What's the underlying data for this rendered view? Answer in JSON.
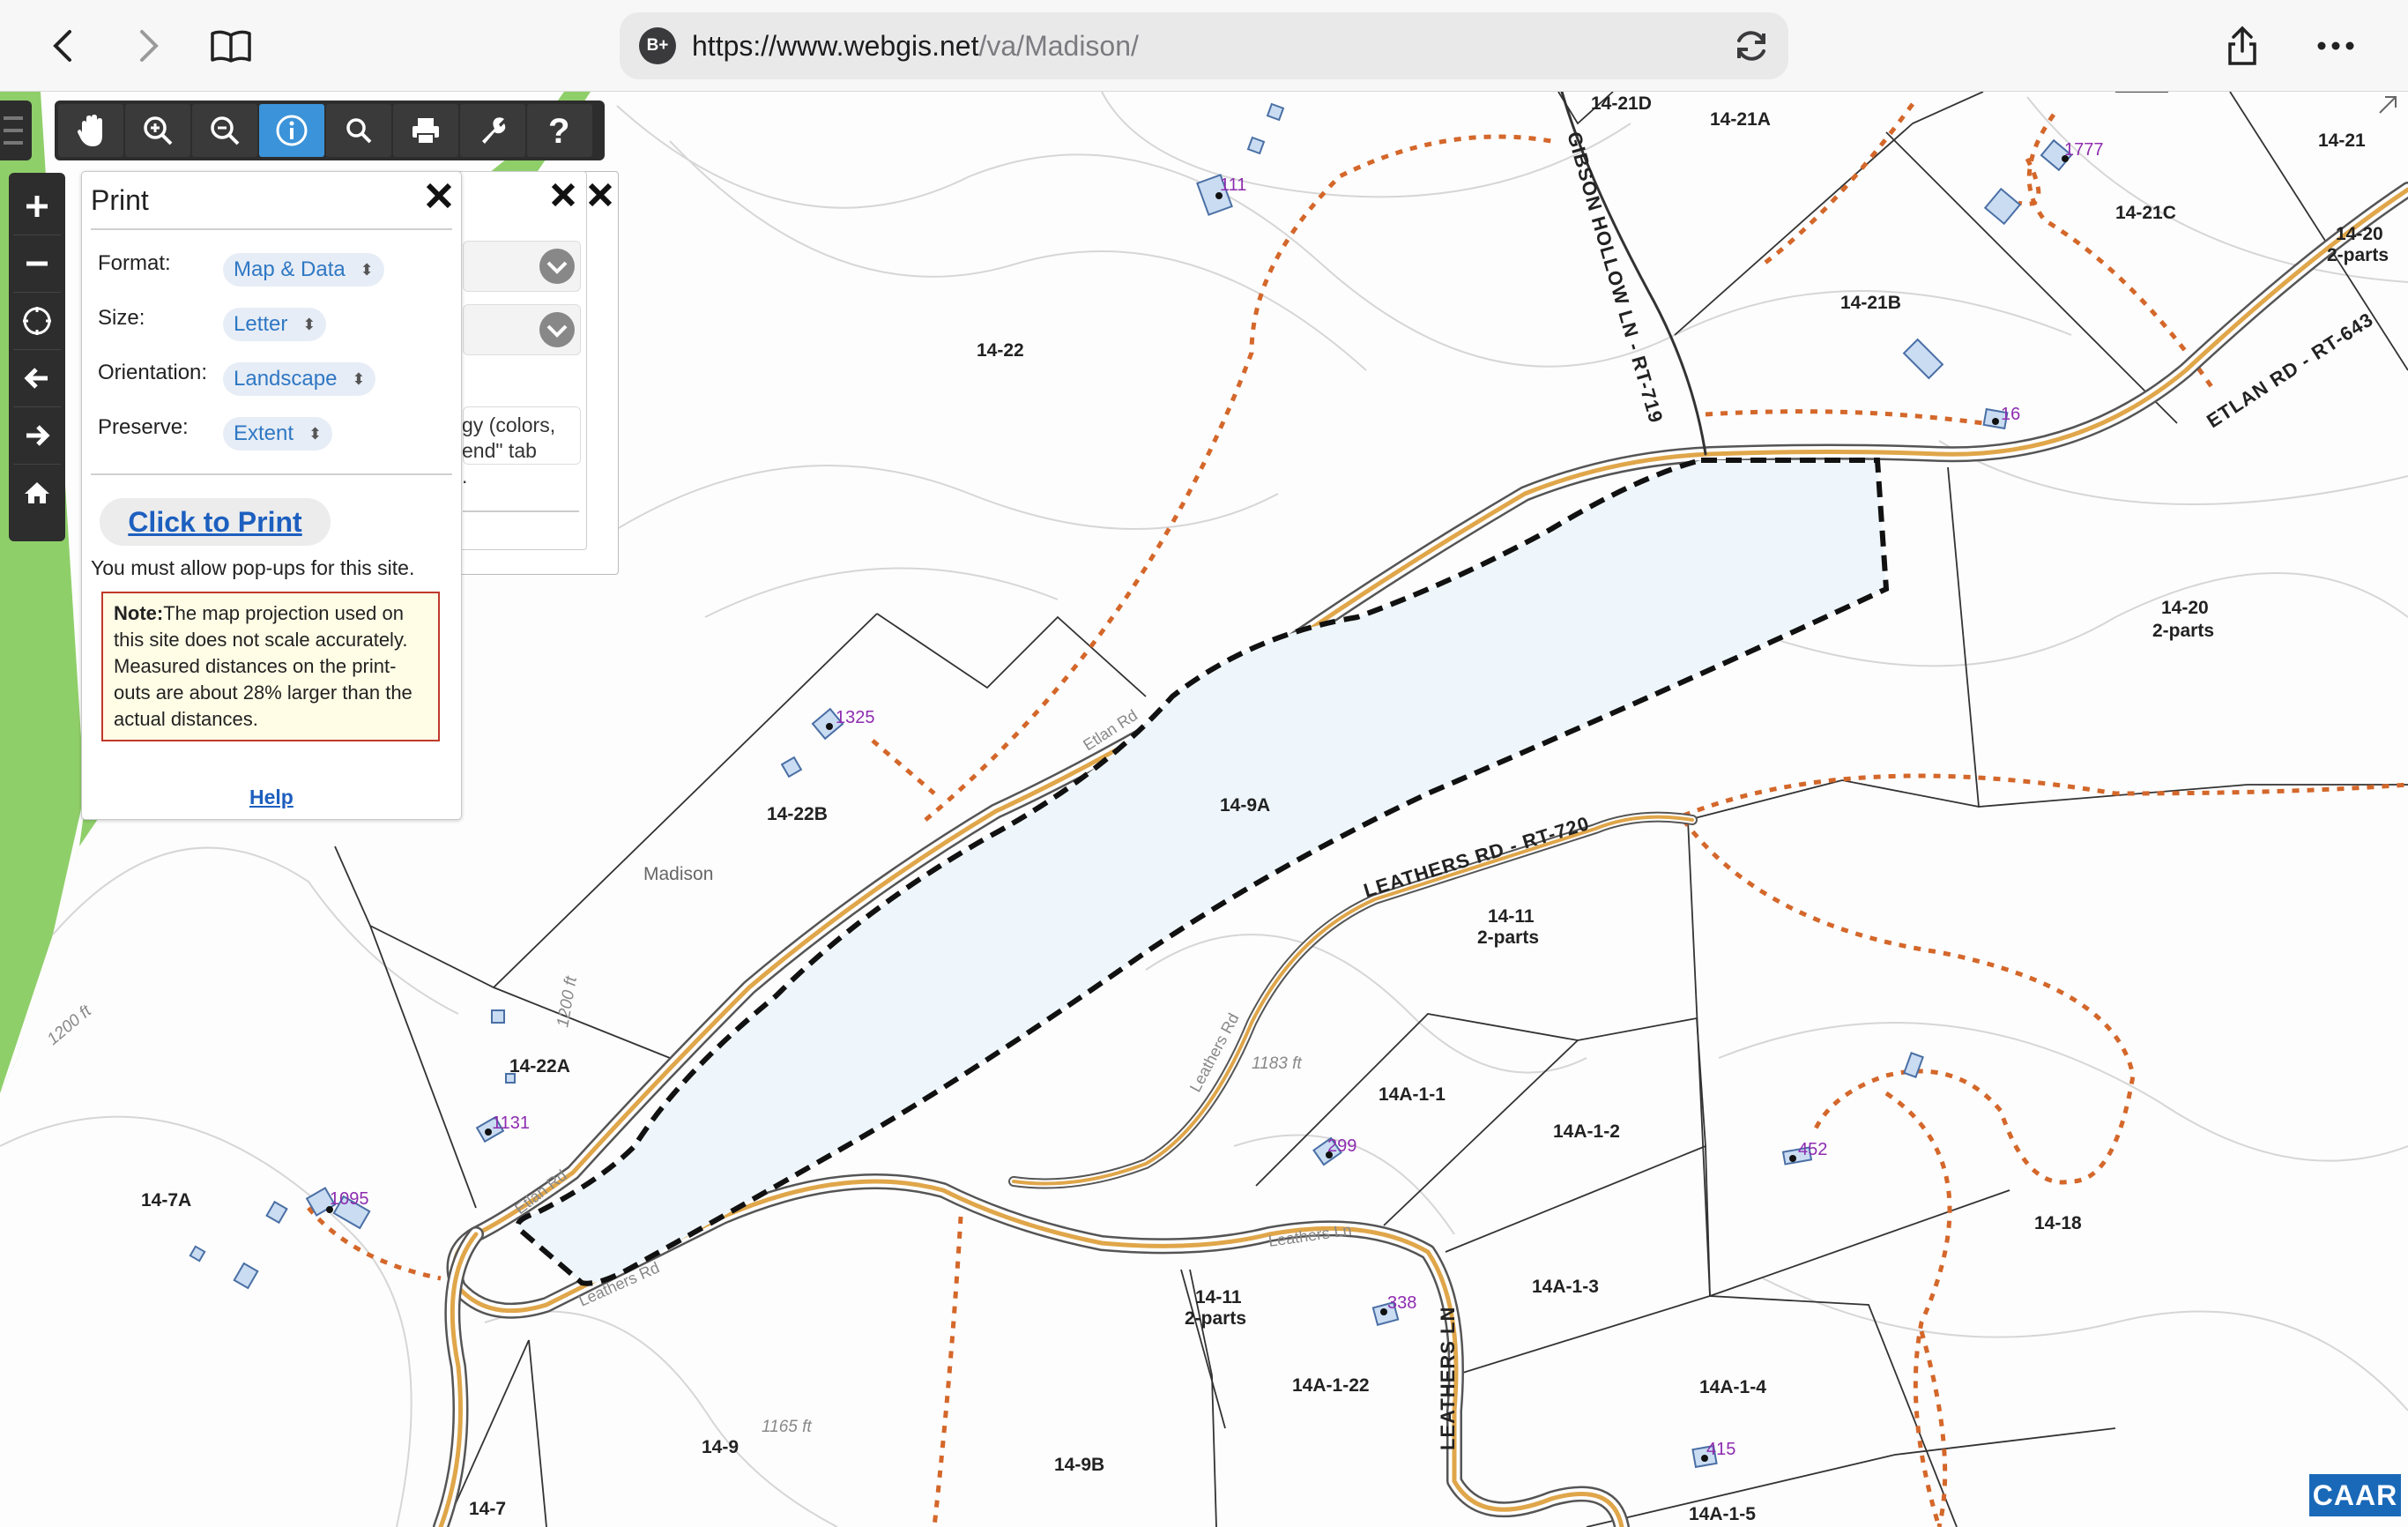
{
  "browser": {
    "url_host": "https://www.webgis.net",
    "url_path": "/va/Madison/",
    "badge": "B+"
  },
  "print_panel": {
    "title": "Print",
    "format_label": "Format:",
    "format_value": "Map & Data",
    "size_label": "Size:",
    "size_value": "Letter",
    "orientation_label": "Orientation:",
    "orientation_value": "Landscape",
    "preserve_label": "Preserve:",
    "preserve_value": "Extent",
    "print_button": "Click to Print",
    "popup_message": "You must allow pop-ups for this site.",
    "note_bold": "Note:",
    "note_text": "The map projection used on this site does not scale accurately. Measured distances on the print-outs are about 28% larger than the actual distances.",
    "help_link": "Help"
  },
  "hidden_panel_text": {
    "line1": "gy (colors,",
    "line2": "end\" tab",
    "line3": "."
  },
  "map": {
    "parcels": [
      "14-21D",
      "14-21A",
      "14-21",
      "14-21C",
      "14-20",
      "2-parts",
      "14-21B",
      "14-22",
      "14-20",
      "2-parts",
      "14-22B",
      "14-9A",
      "14-11",
      "2-parts",
      "14-22A",
      "14A-1-1",
      "14A-1-2",
      "14-7A",
      "14-18",
      "14-11",
      "2-parts",
      "14A-1-3",
      "14A-1-22",
      "14A-1-4",
      "14-9",
      "14-9B",
      "14-7",
      "14A-1-5"
    ],
    "addresses": [
      "111",
      "1777",
      "16",
      "1325",
      "1131",
      "1095",
      "299",
      "452",
      "338",
      "415"
    ],
    "roads": [
      "GIBSON HOLLOW LN - RT-719",
      "ETLAN RD - RT-643",
      "LEATHERS RD - RT-720",
      "LEATHERS LN"
    ],
    "small_road_labels": [
      "Etlan Rd",
      "Etlan Rd",
      "Leathers Rd",
      "Leathers Rd",
      "Leathers Ln"
    ],
    "elevations": [
      "1200 ft",
      "1200 ft",
      "1183 ft",
      "1165 ft"
    ],
    "place": "Madison"
  },
  "branding": {
    "caar": "CAAR"
  }
}
